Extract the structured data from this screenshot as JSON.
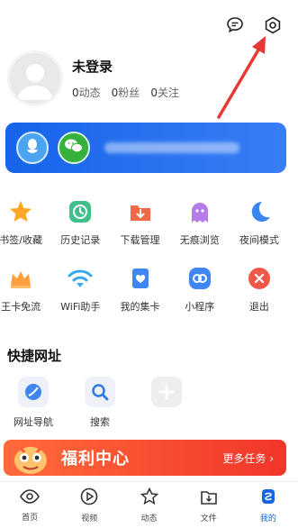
{
  "header": {
    "message_icon": "message-icon",
    "settings_icon": "gear-icon"
  },
  "profile": {
    "name": "未登录",
    "stats": [
      {
        "value": "0",
        "label": "动态"
      },
      {
        "value": "0",
        "label": "粉丝"
      },
      {
        "value": "0",
        "label": "关注"
      }
    ]
  },
  "login_card": {
    "qq_icon": "qq-icon",
    "wechat_icon": "wechat-icon"
  },
  "features": [
    {
      "label": "书签/收藏",
      "icon": "star-icon"
    },
    {
      "label": "历史记录",
      "icon": "clock-icon"
    },
    {
      "label": "下载管理",
      "icon": "download-folder-icon"
    },
    {
      "label": "无痕浏览",
      "icon": "ghost-icon"
    },
    {
      "label": "夜间模式",
      "icon": "moon-icon"
    },
    {
      "label": "王卡免流",
      "icon": "crown-icon"
    },
    {
      "label": "WiFi助手",
      "icon": "wifi-icon"
    },
    {
      "label": "我的集卡",
      "icon": "card-icon"
    },
    {
      "label": "小程序",
      "icon": "mini-program-icon"
    },
    {
      "label": "退出",
      "icon": "exit-icon"
    }
  ],
  "quick_links": {
    "title": "快捷网址",
    "items": [
      {
        "label": "网址导航",
        "icon": "compass-icon"
      },
      {
        "label": "搜索",
        "icon": "search-icon"
      },
      {
        "label": "",
        "icon": "plus-icon"
      }
    ]
  },
  "welfare": {
    "title": "福利中心",
    "more": "更多任务 ›"
  },
  "tabs": [
    {
      "label": "首页",
      "icon": "eye-icon",
      "active": false
    },
    {
      "label": "视频",
      "icon": "play-icon",
      "active": false
    },
    {
      "label": "动态",
      "icon": "star-outline-icon",
      "active": false
    },
    {
      "label": "文件",
      "icon": "file-icon",
      "active": false
    },
    {
      "label": "我的",
      "icon": "profile-icon",
      "active": true
    }
  ],
  "colors": {
    "accent": "#1764ea",
    "annotation": "#e53935",
    "welfare": "#f2362a"
  }
}
